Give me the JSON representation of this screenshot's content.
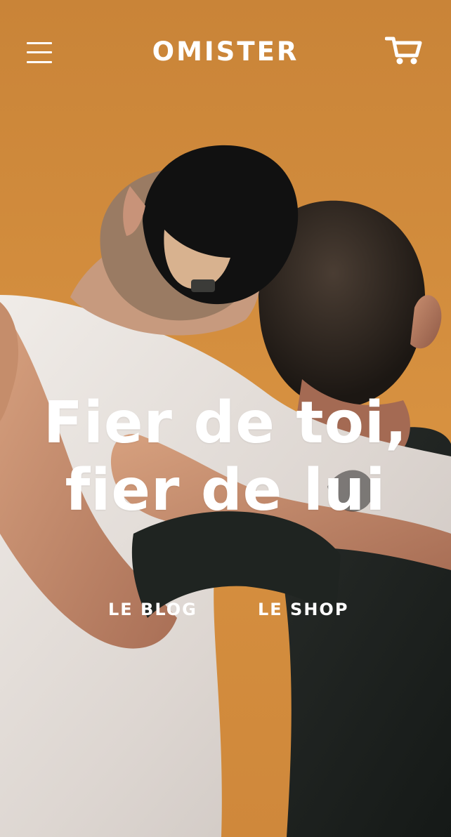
{
  "header": {
    "brand": "OMISTER",
    "menu_icon": "hamburger-menu-icon",
    "cart_icon": "shopping-cart-icon"
  },
  "hero": {
    "headline_line_1": "Fier de toi,",
    "headline_line_2": "fier de lui",
    "image_subject": "two people embracing against an orange background"
  },
  "nav": {
    "blog": "LE BLOG",
    "shop": "LE SHOP"
  },
  "colors": {
    "background": "#d18a3b",
    "text": "#ffffff",
    "shirt_white": "#e8e3df",
    "shirt_dark": "#1f2421",
    "cap": "#111111"
  }
}
